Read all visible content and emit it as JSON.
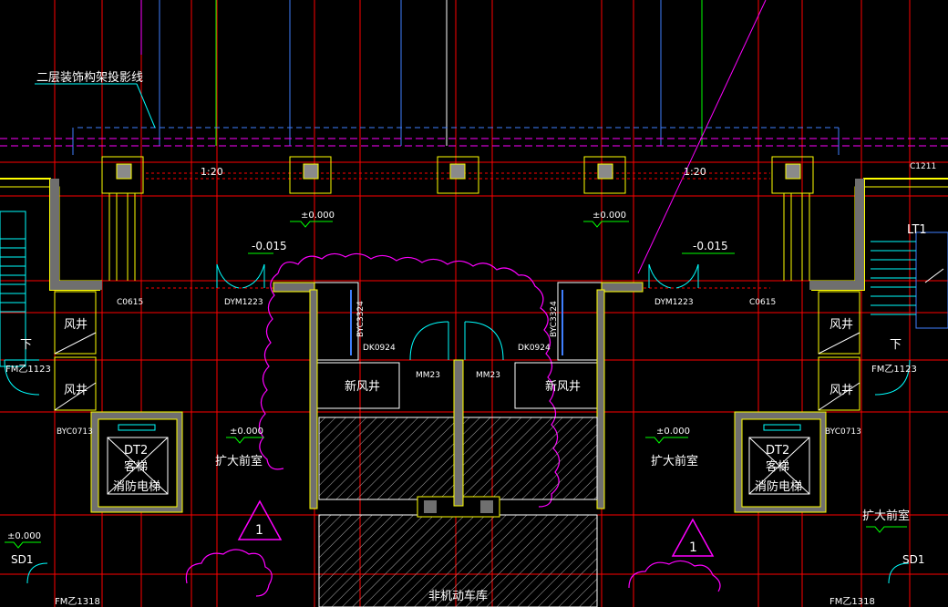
{
  "annotations": {
    "decor_projection": "二层装饰构架投影线",
    "scale_left": "1:20",
    "scale_right": "1:20",
    "level_a": "±0.000",
    "level_b": "±0.000",
    "level_c": "±0.000",
    "level_d": "±0.000",
    "level_e": "±0.000",
    "level_neg_left": "-0.015",
    "level_neg_right": "-0.015",
    "window_c1211": "C1211",
    "window_c0615_left": "C0615",
    "window_c0615_right": "C0615",
    "door_dym_left": "DYM1223",
    "door_dym_right": "DYM1223",
    "byc_left": "BYC3324",
    "byc_right": "BYC3324",
    "dk_left": "DK0924",
    "dk_right": "DK0924",
    "mm_left": "MM23",
    "mm_right": "MM23",
    "byc_small_left": "BYC0713",
    "byc_small_right": "BYC0713",
    "room_fengjing": "风井",
    "room_new_fengjing": "新风井",
    "lobby": "扩大前室",
    "elevator_code": "DT2",
    "elevator_name_1": "客梯",
    "elevator_name_2": "消防电梯",
    "stair_down": "下",
    "fm_left_1123": "FM乙1123",
    "fm_right_1123": "FM乙1123",
    "fm_left_1318": "FM乙1318",
    "fm_right_1318": "FM乙1318",
    "sd1": "SD1",
    "lt1": "LT1",
    "revision_mark": "1",
    "garage": "非机动车库"
  },
  "colors": {
    "background": "#000000",
    "axis_red": "#ff0000",
    "wall_yellow": "#ffff00",
    "wall_gray": "#8a8a8a",
    "text_white": "#ffffff",
    "dim_green": "#00ff00",
    "magenta": "#ff00ff",
    "cyan": "#00ffff",
    "blue": "#3f7fff",
    "orange": "#ff8c00"
  }
}
